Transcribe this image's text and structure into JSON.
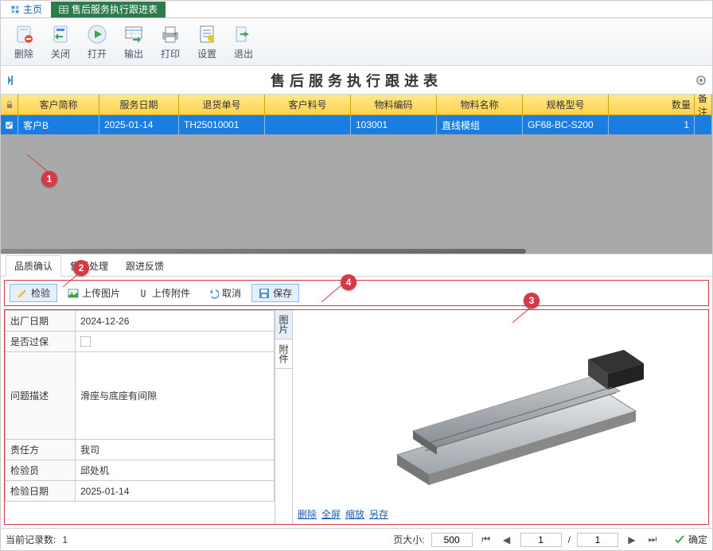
{
  "app_tabs": {
    "home": "主页",
    "active": "售后服务执行跟进表"
  },
  "toolbar": {
    "delete": "删除",
    "close": "关闭",
    "open": "打开",
    "export": "输出",
    "print": "打印",
    "settings": "设置",
    "exit": "退出"
  },
  "title": "售后服务执行跟进表",
  "annotations": {
    "a1": "1",
    "a2": "2",
    "a3": "3",
    "a4": "4"
  },
  "grid": {
    "headers": {
      "customer": "客户简称",
      "date": "服务日期",
      "return_no": "退货单号",
      "cust_part": "客户料号",
      "material": "物料编码",
      "name": "物料名称",
      "spec": "规格型号",
      "qty": "数量",
      "remark": "备注"
    },
    "rows": [
      {
        "customer": "客户B",
        "date": "2025-01-14",
        "return_no": "TH25010001",
        "cust_part": "",
        "material": "103001",
        "name": "直线模组",
        "spec": "GF68-BC-S200",
        "qty": "1",
        "remark": ""
      }
    ]
  },
  "detail_tabs": {
    "quality": "品质确认",
    "after": "售后处理",
    "feedback": "跟进反馈"
  },
  "sub_toolbar": {
    "inspect": "检验",
    "upload_img": "上传图片",
    "upload_file": "上传附件",
    "cancel": "取消",
    "save": "保存"
  },
  "form": {
    "ship_date_lbl": "出厂日期",
    "ship_date": "2024-12-26",
    "warranty_lbl": "是否过保",
    "warranty": false,
    "issue_lbl": "问题描述",
    "issue": "滑座与底座有间隙",
    "responsible_lbl": "责任方",
    "responsible": "我司",
    "inspector_lbl": "检验员",
    "inspector": "邱处机",
    "inspect_date_lbl": "检验日期",
    "inspect_date": "2025-01-14"
  },
  "side_tabs": {
    "image": "图片",
    "attach": "附件"
  },
  "img_links": {
    "delete": "删除",
    "fullscreen": "全屏",
    "zoom": "缩放",
    "saveas": "另存"
  },
  "status": {
    "records_lbl": "当前记录数:",
    "records": "1",
    "pagesize_lbl": "页大小:",
    "pagesize": "500",
    "page": "1",
    "total": "1",
    "confirm": "确定"
  }
}
